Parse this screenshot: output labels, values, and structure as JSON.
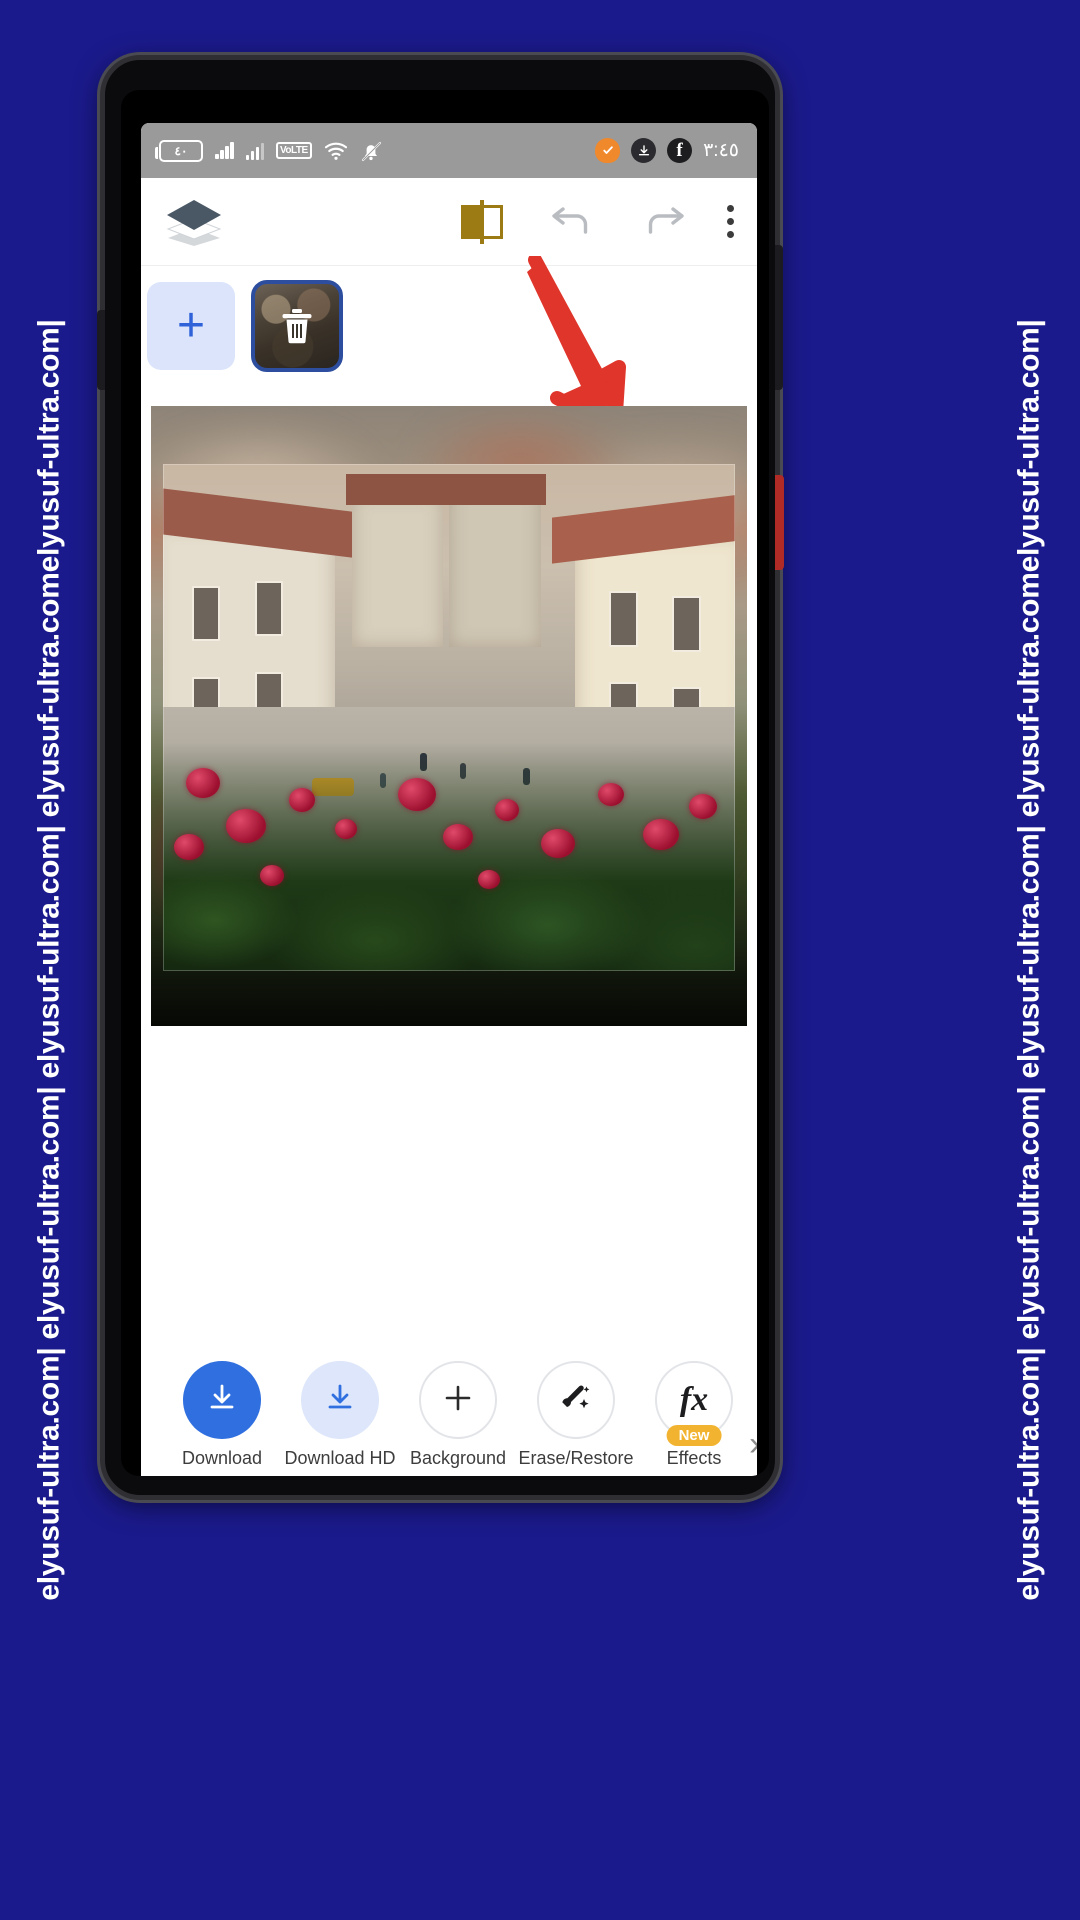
{
  "watermark": {
    "left_text": "elyusuf-ultra.com| elyusuf-ultra.com| elyusuf-ultra.com| elyusuf-ultra.comelyusuf-ultra.com|",
    "right_text": "elyusuf-ultra.com| elyusuf-ultra.com| elyusuf-ultra.com| elyusuf-ultra.comelyusuf-ultra.com|"
  },
  "statusbar": {
    "battery_label": "٤٠",
    "volte_label": "VoLTE",
    "wifi_icon": "wifi-icon",
    "bell_icon": "bell-muted-icon",
    "signal_icon": "signal-bars-icon",
    "shield_icon": "shield-icon",
    "facebook_icon": "facebook-icon",
    "facebook_glyph": "f",
    "download_icon": "download-status-icon",
    "time": "٣:٤٥",
    "background_color": "#9a9a9a"
  },
  "toolbar": {
    "layers_icon": "layers-icon",
    "compare_icon": "compare-split-icon",
    "undo_icon": "undo-icon",
    "redo_icon": "redo-icon",
    "menu_icon": "overflow-menu-icon",
    "compare_color": "#9c7b15",
    "undo_color": "#b9bcc1"
  },
  "layers": {
    "add_label": "+",
    "add_icon": "plus-icon",
    "delete_icon": "trash-icon",
    "selected_border_color": "#2d4e9e",
    "add_background": "#dbe4fb"
  },
  "annotation": {
    "arrow_icon": "arrow-down-pointer-icon",
    "arrow_color": "#e0352b"
  },
  "actions": [
    {
      "label": "Download",
      "icon": "download-icon",
      "style": "primary",
      "badge": ""
    },
    {
      "label": "Download HD",
      "icon": "download-hd-icon",
      "style": "soft",
      "badge": ""
    },
    {
      "label": "Background",
      "icon": "plus-icon",
      "style": "outline",
      "badge": ""
    },
    {
      "label": "Erase/Restore",
      "icon": "magic-eraser-icon",
      "style": "outline",
      "badge": ""
    },
    {
      "label": "Effects",
      "icon": "fx-icon",
      "style": "outline",
      "badge": "New"
    }
  ],
  "next_chevron": "›",
  "colors": {
    "accent_blue": "#2f6fe0",
    "soft_blue": "#dde6fa",
    "badge_yellow": "#f2b430",
    "frame_blue": "#1b1a8c"
  }
}
